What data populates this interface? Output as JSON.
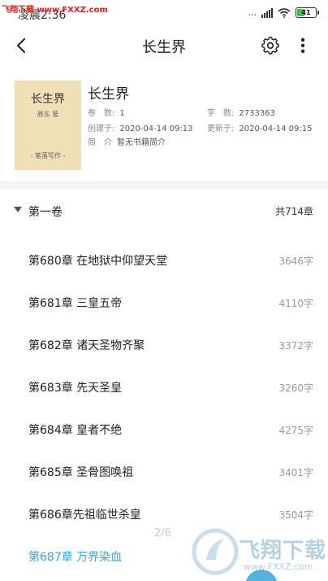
{
  "status_bar": {
    "time": "凌晨2:36",
    "watermark": "飞翔下载 www.FXXZ.com",
    "network": "...",
    "battery_level": "41",
    "battery_fraction": 0.41
  },
  "nav": {
    "back_icon": "chevron-left-icon",
    "title": "长生界",
    "settings_icon": "gear-icon",
    "more_icon": "more-vertical-icon"
  },
  "book": {
    "cover_title": "长生界",
    "cover_author": "辰东 著",
    "cover_publisher": "- 笔落写作 -",
    "title": "长生界",
    "volumes_label": "卷　数:",
    "volumes_value": "1",
    "words_label": "字　数:",
    "words_value": "2733363",
    "created_label": "创建于:",
    "created_value": "2020-04-14 09:13",
    "updated_label": "更新于:",
    "updated_value": "2020-04-14 09:15",
    "intro_label": "简　介",
    "intro_value": "暂无书籍简介"
  },
  "volume": {
    "name": "第一卷",
    "count": "共714章"
  },
  "chapters": [
    {
      "title": "第680章 在地狱中仰望天堂",
      "words": "3646字"
    },
    {
      "title": "第681章 三皇五帝",
      "words": "4110字"
    },
    {
      "title": "第682章 诸天圣物齐聚",
      "words": "3372字"
    },
    {
      "title": "第683章 先天圣皇",
      "words": "3260字"
    },
    {
      "title": "第684章 皇者不绝",
      "words": "4275字"
    },
    {
      "title": "第685章 圣骨图唤祖",
      "words": "3401字"
    },
    {
      "title": "第686章先祖临世杀皇",
      "words": "3504字"
    },
    {
      "title": "第687章 万界染血",
      "words": ""
    }
  ],
  "page_indicator": "2/6",
  "watermark_bottom": {
    "text": "飞翔下载",
    "url": "www.FXXZ.com"
  },
  "colors": {
    "accent": "#3aa3d9",
    "cover": "#efe0b8",
    "band": "#f4f4f4"
  }
}
